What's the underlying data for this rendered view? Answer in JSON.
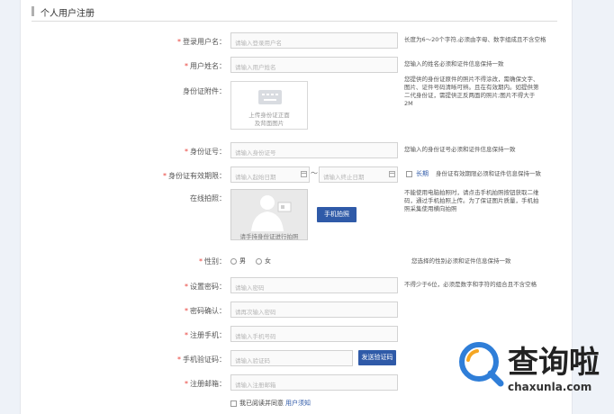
{
  "header": {
    "title": "个人用户注册"
  },
  "fields": {
    "username": {
      "label": "登录用户名：",
      "placeholder": "请输入登录用户名",
      "hint": "长度为6～20个字符,必须由字母、数字组成且不含空格"
    },
    "realname": {
      "label": "用户姓名：",
      "placeholder": "请输入用户姓名",
      "hint": "您输入的姓名必须和证件信息保持一致"
    },
    "idattach": {
      "label": "身份证附件：",
      "upload_text_1": "上传身份证正面",
      "upload_text_2": "及背面图片",
      "hint_lines": [
        "您提供的身份证原件的照片不得涂改，需确保文字、",
        "图片、证件号码清晰可辨。且在有效期内。如提供第",
        "二代身份证，需提供正反两面的照片;图片不得大于",
        "2M"
      ]
    },
    "idnumber": {
      "label": "身份证号：",
      "placeholder": "请输入身份证号",
      "hint": "您输入的身份证号必须和证件信息保持一致"
    },
    "validity": {
      "label": "身份证有效期限：",
      "start_placeholder": "请输入起始日期",
      "separator": "～",
      "end_placeholder": "请输入终止日期",
      "longterm_label": "长期",
      "hint": "身份证有效期限必须和证件信息保持一致"
    },
    "photo": {
      "label": "在线拍照：",
      "caption": "请手持身份证进行拍照",
      "button": "手机拍照",
      "hint_lines": [
        "不能使用电脑拍照时，请点击手机拍照按钮获取二维",
        "码，通过手机拍照上传。为了保证图片质量，手机拍",
        "照采集使用横向拍照"
      ]
    },
    "gender": {
      "label": "性别：",
      "male": "男",
      "female": "女",
      "hint": "您选择的性别必须和证件信息保持一致"
    },
    "password": {
      "label": "设置密码：",
      "placeholder": "请输入密码",
      "hint": "不得少于6位，必须是数字和字符的组合且不含空格"
    },
    "confirm": {
      "label": "密码确认：",
      "placeholder": "请再次输入密码"
    },
    "phone": {
      "label": "注册手机：",
      "placeholder": "请输入手机号码"
    },
    "code": {
      "label": "手机验证码：",
      "placeholder": "请输入验证码",
      "button": "发送验证码"
    },
    "email": {
      "label": "注册邮箱：",
      "placeholder": "请输入注册邮箱"
    },
    "agree": {
      "text": "我已阅读并同意",
      "link": "用户须知"
    }
  },
  "watermark": {
    "title": "查询啦",
    "url": "chaxunla.com"
  },
  "colors": {
    "primary": "#2f5aa8",
    "required": "#e8403a",
    "watermark_blue": "#2f7ed8",
    "watermark_orange": "#f5a623"
  }
}
